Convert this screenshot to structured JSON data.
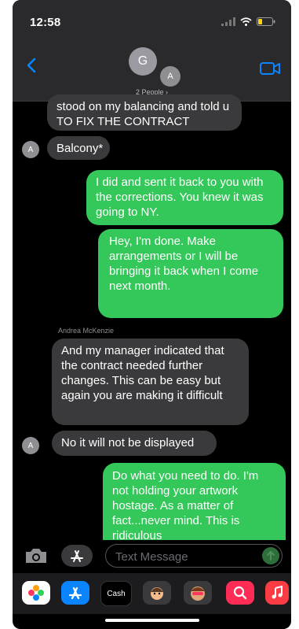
{
  "status": {
    "time": "12:58"
  },
  "header": {
    "avatar_g": "G",
    "avatar_a": "A",
    "people_label": "2 People",
    "people_chevron": "›"
  },
  "messages": [
    {
      "text": "stood on my balancing and told u TO FIX THE CONTRACT"
    },
    {
      "text": "Balcony*",
      "avatar": "A"
    },
    {
      "text": "I did and sent it back to you with the corrections. You knew it was going to NY."
    },
    {
      "text": "Hey, I'm done. Make arrangements or I will be bringing it back when I come next month."
    },
    {
      "sender": "Andrea McKenzie",
      "text": "And my manager indicated that the contract needed further changes. This can be easy but again you are making it difficult"
    },
    {
      "text": "No it will not be displayed",
      "avatar": "A"
    },
    {
      "text": "Do what you need to do. I'm not holding your artwork hostage. As a matter of fact...never mind. This is ridiculous"
    }
  ],
  "input": {
    "placeholder": "Text Message"
  },
  "app_tray": [
    {
      "name": "photos-app-icon",
      "label": ""
    },
    {
      "name": "app-store-icon",
      "label": ""
    },
    {
      "name": "apple-cash-icon",
      "label": "Cash"
    },
    {
      "name": "memoji-icon",
      "label": ""
    },
    {
      "name": "memoji-stickers-icon",
      "label": ""
    },
    {
      "name": "images-search-icon",
      "label": ""
    },
    {
      "name": "music-app-icon",
      "label": ""
    }
  ],
  "colors": {
    "outgoing": "#34c759",
    "incoming": "#3a3a3c",
    "accent": "#0a84ff"
  }
}
